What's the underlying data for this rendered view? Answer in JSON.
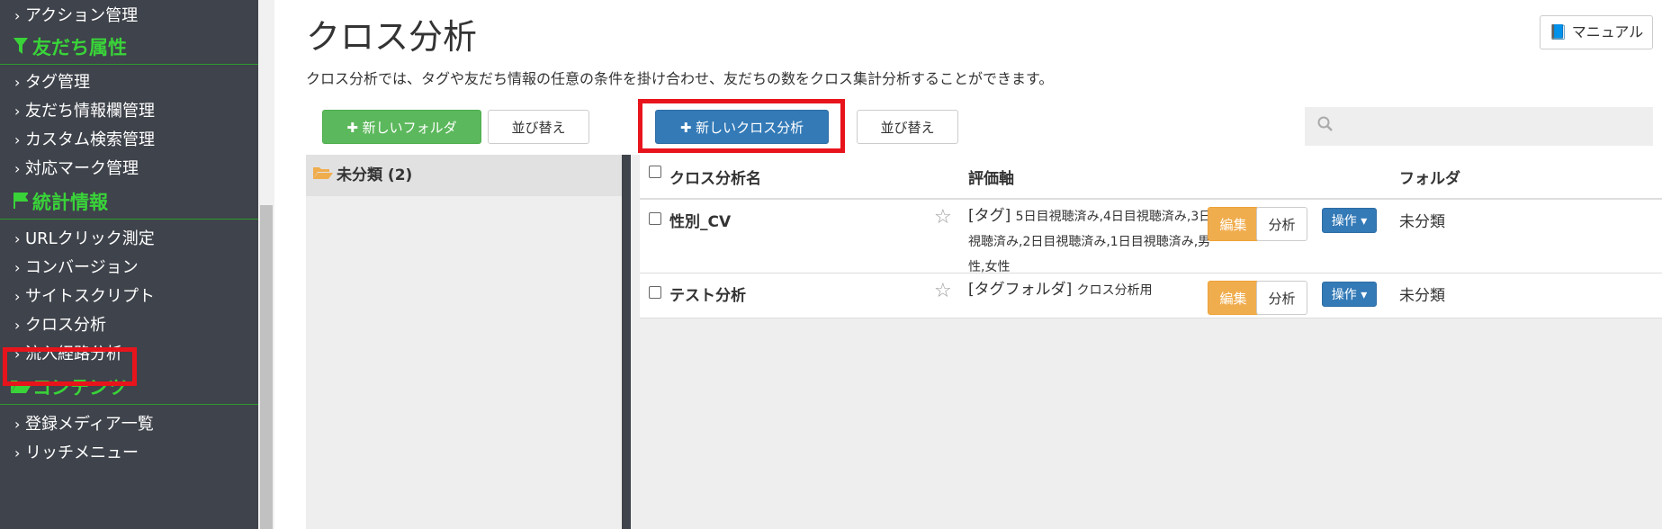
{
  "sidebar": {
    "items": [
      {
        "label": "アクション管理",
        "type": "item"
      },
      {
        "label": "友だち属性",
        "type": "head",
        "icon": "filter-icon"
      },
      {
        "label": "タグ管理",
        "type": "item"
      },
      {
        "label": "友だち情報欄管理",
        "type": "item"
      },
      {
        "label": "カスタム検索管理",
        "type": "item"
      },
      {
        "label": "対応マーク管理",
        "type": "item"
      },
      {
        "label": "統計情報",
        "type": "head",
        "icon": "flag-icon"
      },
      {
        "label": "URLクリック測定",
        "type": "item"
      },
      {
        "label": "コンバージョン",
        "type": "item"
      },
      {
        "label": "サイトスクリプト",
        "type": "item"
      },
      {
        "label": "クロス分析",
        "type": "item",
        "highlighted": true
      },
      {
        "label": "流入経路分析",
        "type": "item"
      },
      {
        "label": "コンテンツ",
        "type": "head",
        "icon": "folder-open-icon"
      },
      {
        "label": "登録メディア一覧",
        "type": "item"
      },
      {
        "label": "リッチメニュー",
        "type": "item"
      }
    ]
  },
  "page": {
    "title": "クロス分析",
    "description": "クロス分析では、タグや友だち情報の任意の条件を掛け合わせ、友だちの数をクロス集計分析することができます。",
    "manual_label": "マニュアル"
  },
  "toolbar": {
    "new_folder_label": "新しいフォルダ",
    "sort_folder_label": "並び替え",
    "new_analysis_label": "新しいクロス分析",
    "sort_analysis_label": "並び替え",
    "search_placeholder": ""
  },
  "folders": [
    {
      "name": "未分類 (2)"
    }
  ],
  "table": {
    "headers": {
      "name": "クロス分析名",
      "axis": "評価軸",
      "folder": "フォルダ"
    },
    "rows": [
      {
        "name": "性別_CV",
        "axis_type": "[タグ]",
        "axis_value": "5日目視聴済み,4日目視聴済み,3日目視聴済み,2日目視聴済み,1日目視聴済み,男性,女性",
        "edit_label": "編集",
        "analyze_label": "分析",
        "operation_label": "操作",
        "folder": "未分類"
      },
      {
        "name": "テスト分析",
        "axis_type": "[タグフォルダ]",
        "axis_value": "クロス分析用",
        "edit_label": "編集",
        "analyze_label": "分析",
        "operation_label": "操作",
        "folder": "未分類"
      }
    ]
  },
  "colors": {
    "sidebar_bg": "#3f434b",
    "sidebar_head": "#39d339",
    "highlight": "#e8141c",
    "primary": "#337ab7",
    "success": "#5cb85c",
    "warning": "#f0ad4e"
  }
}
